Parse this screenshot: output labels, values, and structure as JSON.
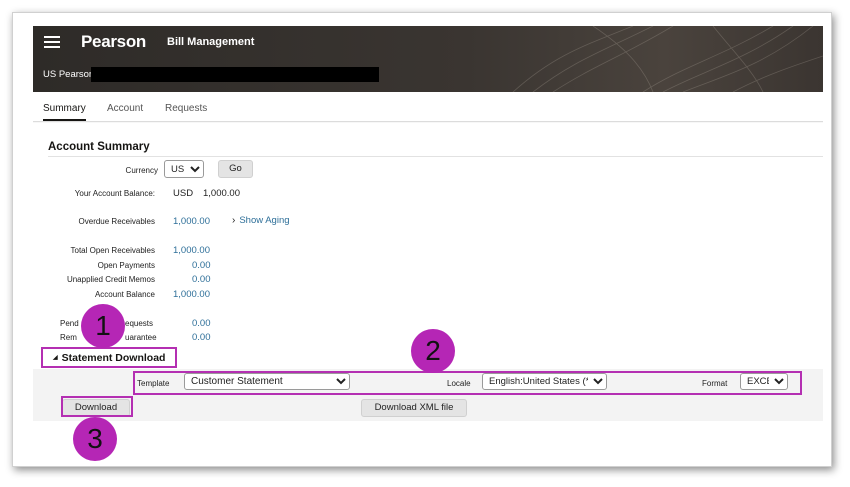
{
  "header": {
    "logo": "Pearson",
    "app_title": "Bill Management",
    "org_name": "US Pearson"
  },
  "tabs": [
    {
      "label": "Summary",
      "active": true
    },
    {
      "label": "Account",
      "active": false
    },
    {
      "label": "Requests",
      "active": false
    }
  ],
  "account_summary": {
    "title": "Account Summary",
    "currency_label": "Currency",
    "currency_value": "USD",
    "go_label": "Go",
    "balance_label": "Your Account Balance:",
    "balance_currency": "USD",
    "balance_value": "1,000.00",
    "overdue_label": "Overdue Receivables",
    "overdue_value": "1,000.00",
    "show_aging": "Show Aging",
    "total_open_label": "Total Open Receivables",
    "total_open_value": "1,000.00",
    "open_payments_label": "Open Payments",
    "open_payments_value": "0.00",
    "unapplied_label": "Unapplied Credit Memos",
    "unapplied_value": "0.00",
    "account_balance_label": "Account Balance",
    "account_balance_value": "1,000.00",
    "pending_label": "Pend",
    "pending_label_tail": "equests",
    "pending_value": "0.00",
    "remaining_label": "Rem",
    "remaining_label_tail": "uarantee",
    "remaining_value": "0.00"
  },
  "statement": {
    "title": "Statement Download",
    "template_label": "Template",
    "template_value": "Customer Statement",
    "locale_label": "Locale",
    "locale_value": "English:United States (*)",
    "format_label": "Format",
    "format_value": "EXCEL",
    "download_label": "Download",
    "download_xml_label": "Download XML file"
  },
  "callouts": {
    "one": "1",
    "two": "2",
    "three": "3"
  },
  "colors": {
    "highlight": "#b42fb2",
    "link": "#2e6f99",
    "banner": "#2e2b28"
  }
}
